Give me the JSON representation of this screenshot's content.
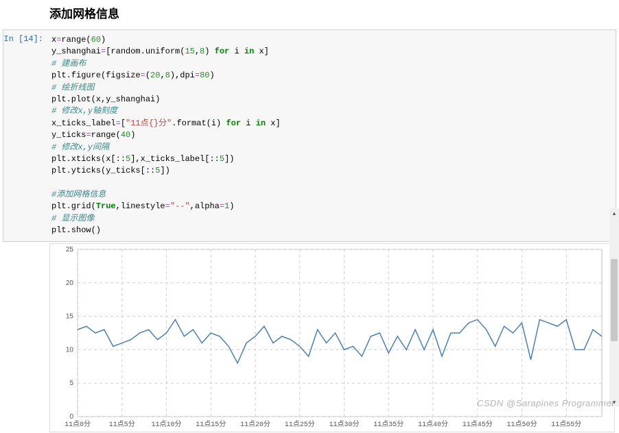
{
  "heading": "添加网格信息",
  "prompt": "In  [14]:",
  "code_lines": [
    {
      "t": "plain",
      "segs": [
        {
          "c": "",
          "v": "x"
        },
        {
          "c": "op",
          "v": "="
        },
        {
          "c": "",
          "v": "range("
        },
        {
          "c": "num",
          "v": "60"
        },
        {
          "c": "",
          "v": ")"
        }
      ]
    },
    {
      "t": "plain",
      "segs": [
        {
          "c": "",
          "v": "y_shanghai"
        },
        {
          "c": "op",
          "v": "="
        },
        {
          "c": "",
          "v": "[random.uniform("
        },
        {
          "c": "num",
          "v": "15"
        },
        {
          "c": "",
          "v": ","
        },
        {
          "c": "num",
          "v": "8"
        },
        {
          "c": "",
          "v": ") "
        },
        {
          "c": "kw",
          "v": "for"
        },
        {
          "c": "",
          "v": " i "
        },
        {
          "c": "kw",
          "v": "in"
        },
        {
          "c": "",
          "v": " x]"
        }
      ]
    },
    {
      "t": "cmt",
      "segs": [
        {
          "c": "cmt",
          "v": "# 建画布"
        }
      ]
    },
    {
      "t": "plain",
      "segs": [
        {
          "c": "",
          "v": "plt.figure(figsize"
        },
        {
          "c": "op",
          "v": "="
        },
        {
          "c": "",
          "v": "("
        },
        {
          "c": "num",
          "v": "20"
        },
        {
          "c": "",
          "v": ","
        },
        {
          "c": "num",
          "v": "8"
        },
        {
          "c": "",
          "v": "),dpi"
        },
        {
          "c": "op",
          "v": "="
        },
        {
          "c": "num",
          "v": "80"
        },
        {
          "c": "",
          "v": ")"
        }
      ]
    },
    {
      "t": "cmt",
      "segs": [
        {
          "c": "cmt",
          "v": "# 绘折线图"
        }
      ]
    },
    {
      "t": "plain",
      "segs": [
        {
          "c": "",
          "v": "plt.plot(x,y_shanghai)"
        }
      ]
    },
    {
      "t": "cmt",
      "segs": [
        {
          "c": "cmt",
          "v": "# 修改x,y轴刻度"
        }
      ]
    },
    {
      "t": "plain",
      "segs": [
        {
          "c": "",
          "v": "x_ticks_label"
        },
        {
          "c": "op",
          "v": "="
        },
        {
          "c": "",
          "v": "["
        },
        {
          "c": "str",
          "v": "\"11点{}分\""
        },
        {
          "c": "",
          "v": ".format(i) "
        },
        {
          "c": "kw",
          "v": "for"
        },
        {
          "c": "",
          "v": " i "
        },
        {
          "c": "kw",
          "v": "in"
        },
        {
          "c": "",
          "v": " x]"
        }
      ]
    },
    {
      "t": "plain",
      "segs": [
        {
          "c": "",
          "v": "y_ticks"
        },
        {
          "c": "op",
          "v": "="
        },
        {
          "c": "",
          "v": "range("
        },
        {
          "c": "num",
          "v": "40"
        },
        {
          "c": "",
          "v": ")"
        }
      ]
    },
    {
      "t": "cmt",
      "segs": [
        {
          "c": "cmt",
          "v": "# 修改x,y间隔"
        }
      ]
    },
    {
      "t": "plain",
      "segs": [
        {
          "c": "",
          "v": "plt.xticks(x[::"
        },
        {
          "c": "num",
          "v": "5"
        },
        {
          "c": "",
          "v": "],x_ticks_label[::"
        },
        {
          "c": "num",
          "v": "5"
        },
        {
          "c": "",
          "v": "])"
        }
      ]
    },
    {
      "t": "plain",
      "segs": [
        {
          "c": "",
          "v": "plt.yticks(y_ticks[::"
        },
        {
          "c": "num",
          "v": "5"
        },
        {
          "c": "",
          "v": "])"
        }
      ]
    },
    {
      "t": "blank",
      "segs": [
        {
          "c": "",
          "v": " "
        }
      ]
    },
    {
      "t": "cmt",
      "segs": [
        {
          "c": "cmt",
          "v": "#添加网格信息"
        }
      ]
    },
    {
      "t": "plain",
      "segs": [
        {
          "c": "",
          "v": "plt.grid("
        },
        {
          "c": "bl",
          "v": "True"
        },
        {
          "c": "",
          "v": ",linestyle"
        },
        {
          "c": "op",
          "v": "="
        },
        {
          "c": "str",
          "v": "\"--\""
        },
        {
          "c": "",
          "v": ",alpha"
        },
        {
          "c": "op",
          "v": "="
        },
        {
          "c": "num",
          "v": "1"
        },
        {
          "c": "",
          "v": ")"
        }
      ]
    },
    {
      "t": "cmt",
      "segs": [
        {
          "c": "cmt",
          "v": "# 显示图像"
        }
      ]
    },
    {
      "t": "plain",
      "segs": [
        {
          "c": "",
          "v": "plt.show()"
        }
      ]
    }
  ],
  "chart_data": {
    "type": "line",
    "title": "",
    "xlabel": "",
    "ylabel": "",
    "ylim": [
      0,
      25
    ],
    "y_ticks": [
      0,
      5,
      10,
      15,
      20,
      25
    ],
    "x_tick_labels": [
      "11点0分",
      "11点5分",
      "11点10分",
      "11点15分",
      "11点20分",
      "11点25分",
      "11点30分",
      "11点35分",
      "11点40分",
      "11点45分",
      "11点50分",
      "11点55分"
    ],
    "x": [
      0,
      1,
      2,
      3,
      4,
      5,
      6,
      7,
      8,
      9,
      10,
      11,
      12,
      13,
      14,
      15,
      16,
      17,
      18,
      19,
      20,
      21,
      22,
      23,
      24,
      25,
      26,
      27,
      28,
      29,
      30,
      31,
      32,
      33,
      34,
      35,
      36,
      37,
      38,
      39,
      40,
      41,
      42,
      43,
      44,
      45,
      46,
      47,
      48,
      49,
      50,
      51,
      52,
      53,
      54,
      55,
      56,
      57,
      58,
      59
    ],
    "values": [
      13,
      13.5,
      12.5,
      13,
      10.5,
      11,
      11.5,
      12.5,
      13,
      11.5,
      12.5,
      14.5,
      12,
      13,
      11,
      12.5,
      12,
      10.5,
      8,
      11,
      12,
      13.5,
      11,
      12,
      11.5,
      10.5,
      9,
      13,
      11,
      12.5,
      10,
      10.5,
      9,
      12,
      12.5,
      9.5,
      12,
      10,
      13,
      10,
      13,
      9,
      12.5,
      12.5,
      14,
      14.5,
      13,
      10.5,
      13.5,
      12.5,
      14,
      8.5,
      14.5,
      14,
      13.5,
      14.5,
      10,
      10,
      13,
      12
    ]
  },
  "watermark": "CSDN @Sarapines Programmer",
  "scroll": {
    "up": "▴",
    "down": "▾"
  }
}
